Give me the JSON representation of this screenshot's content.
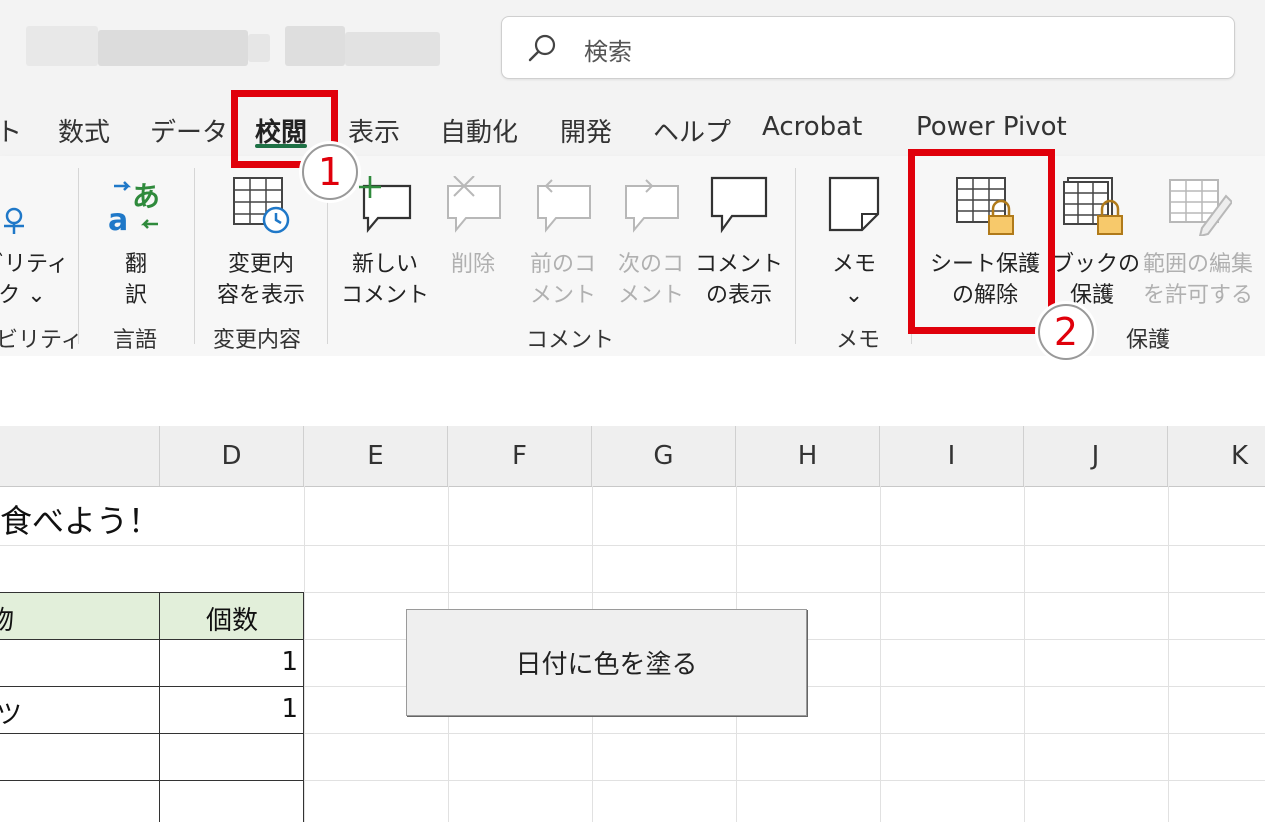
{
  "titlebar": {
    "search_placeholder": "検索"
  },
  "tabs": [
    {
      "label": "ト"
    },
    {
      "label": "数式"
    },
    {
      "label": "データ"
    },
    {
      "label": "校閲",
      "active": true
    },
    {
      "label": "表示"
    },
    {
      "label": "自動化"
    },
    {
      "label": "開発"
    },
    {
      "label": "ヘルプ"
    },
    {
      "label": "Acrobat"
    },
    {
      "label": "Power Pivot"
    }
  ],
  "ribbon": {
    "accessibility": {
      "line1": "ビリティ",
      "line2": "ク ⌄",
      "group": "ビリティ"
    },
    "language": {
      "translate_line1": "翻",
      "translate_line2": "訳",
      "group": "言語"
    },
    "changes": {
      "show_changes_line1": "変更内",
      "show_changes_line2": "容を表示",
      "group": "変更内容"
    },
    "comments": {
      "new_line1": "新しい",
      "new_line2": "コメント",
      "delete_line1": "削除",
      "prev_line1": "前のコ",
      "prev_line2": "メント",
      "next_line1": "次のコ",
      "next_line2": "メント",
      "show_line1": "コメント",
      "show_line2": "の表示",
      "group": "コメント"
    },
    "notes": {
      "memo_line1": "メモ",
      "memo_line2": "⌄",
      "group": "メモ"
    },
    "protect": {
      "unprotect_line1": "シート保護",
      "unprotect_line2": "の解除",
      "book_line1": "ブックの",
      "book_line2": "保護",
      "range_line1": "範囲の編集",
      "range_line2": "を許可する",
      "group": "保護"
    }
  },
  "annotations": {
    "step1": "1",
    "step2": "2"
  },
  "grid": {
    "columns": [
      "D",
      "E",
      "F",
      "G",
      "H",
      "I",
      "J",
      "K"
    ],
    "cells": {
      "title_fragment": "食べよう！",
      "header_left_fragment": "物",
      "header_count": "個数",
      "row1_count": "1",
      "row2_left_fragment": "ツ",
      "row2_count": "1"
    },
    "macro_button_label": "日付に色を塗る"
  },
  "colors": {
    "accent_green": "#1e7145",
    "annotation_red": "#e0000b",
    "table_header_fill": "#e2efda"
  }
}
